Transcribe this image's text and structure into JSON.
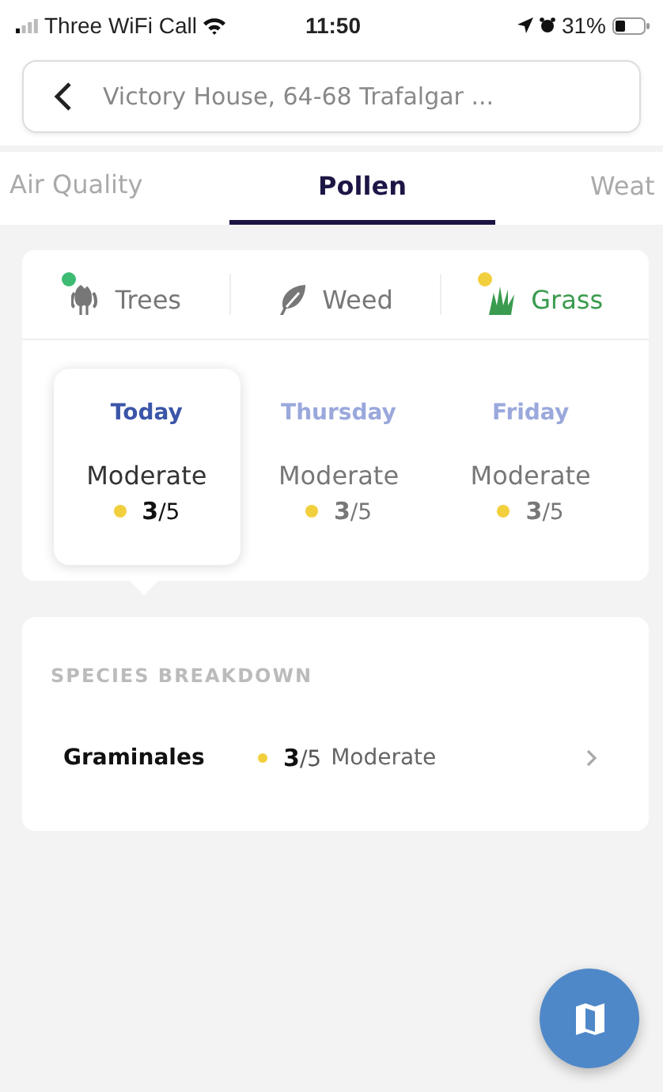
{
  "status_bar": {
    "carrier": "Three WiFi Call",
    "time": "11:50",
    "battery": "31%"
  },
  "search": {
    "value": "Victory House, 64-68 Trafalgar ..."
  },
  "tabs": [
    {
      "label": "Air Quality",
      "selected": false
    },
    {
      "label": "Pollen",
      "selected": true
    },
    {
      "label": "Weat",
      "selected": false
    }
  ],
  "pollen_types": [
    {
      "label": "Trees",
      "kind": "trees",
      "selected": false,
      "color": "#3dbb73"
    },
    {
      "label": "Weed",
      "kind": "leaf",
      "selected": false
    },
    {
      "label": "Grass",
      "kind": "grass",
      "selected": true,
      "color": "#f2cf3c"
    }
  ],
  "days": [
    {
      "label": "Today",
      "selected": true,
      "level": "Moderate",
      "score": "**3**/5",
      "color": "#f2cf3c"
    },
    {
      "label": "Thursday",
      "selected": false,
      "level": "Moderate",
      "score": "**3**/5",
      "color": "#f2cf3c"
    },
    {
      "label": "Friday",
      "selected": false,
      "level": "Moderate",
      "score": "**3**/5",
      "color": "#f2cf3c"
    }
  ],
  "species": {
    "heading": "SPECIES BREAKDOWN",
    "rows": [
      {
        "name": "Graminales",
        "score": "**3**/5",
        "level": "Moderate",
        "color": "#f2cf3c"
      }
    ]
  }
}
